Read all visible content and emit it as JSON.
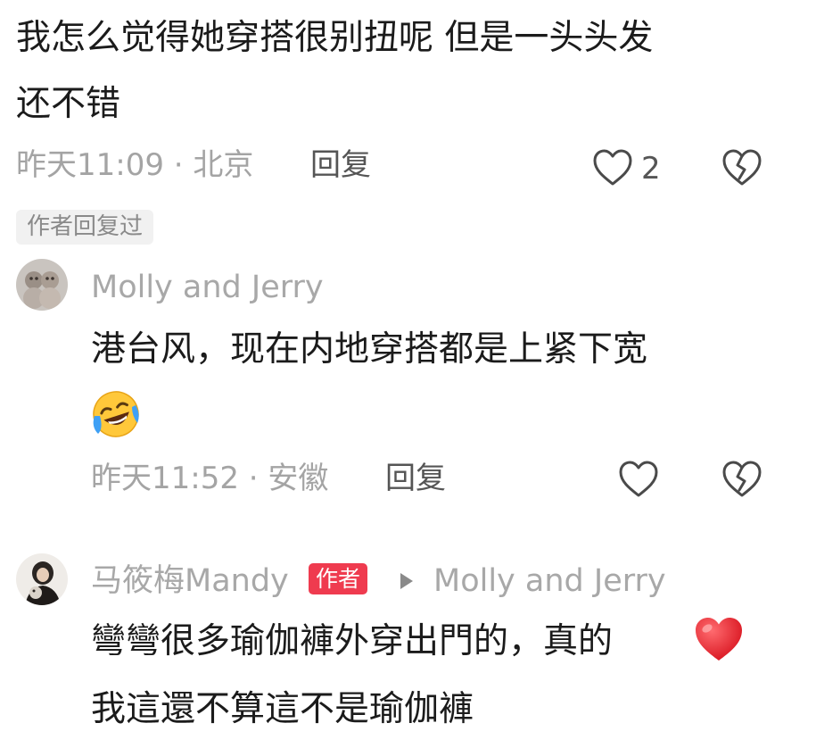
{
  "comment1": {
    "text_line1": "我怎么觉得她穿搭很别扭呢 但是一头头发",
    "text_line2": "还不错",
    "time_location": "昨天11:09 · 北京",
    "reply_label": "回复",
    "like_count": "2",
    "author_replied_tag": "作者回复过"
  },
  "reply1": {
    "username": "Molly and Jerry",
    "text_line1": "港台风，现在内地穿搭都是上紧下宽",
    "emoji": "laughing-crying-emoji",
    "time_location": "昨天11:52 · 安徽",
    "reply_label": "回复"
  },
  "reply2": {
    "username": "马筱梅Mandy",
    "author_badge": "作者",
    "reply_to": "Molly and Jerry",
    "text_line1": "彎彎很多瑜伽褲外穿出門的，真的",
    "emoji": "red-heart-emoji",
    "text_line2": "我這還不算這不是瑜伽褲"
  },
  "colors": {
    "author_badge_bg": "#ef3b4f",
    "heart_red": "#e8232f",
    "meta_gray": "#a4a4a4"
  }
}
